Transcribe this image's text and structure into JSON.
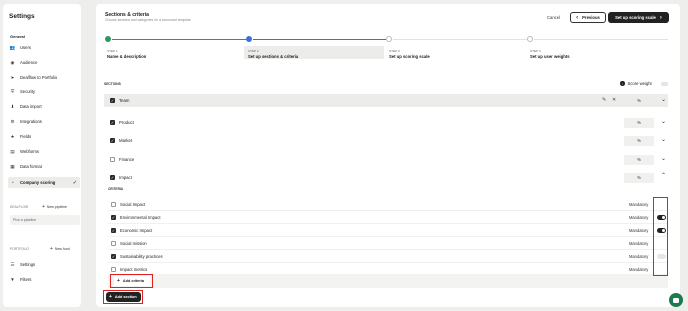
{
  "sidebar": {
    "title": "Settings",
    "general_heading": "General",
    "items": [
      {
        "label": "Users",
        "icon": "users-icon"
      },
      {
        "label": "Audience",
        "icon": "audience-icon"
      },
      {
        "label": "Dealflow to Portfolio",
        "icon": "send-icon"
      },
      {
        "label": "Security",
        "icon": "shield-icon"
      },
      {
        "label": "Data import",
        "icon": "download-icon"
      },
      {
        "label": "Integrations",
        "icon": "plug-icon"
      },
      {
        "label": "Fields",
        "icon": "star-icon"
      },
      {
        "label": "Webforms",
        "icon": "form-icon"
      },
      {
        "label": "Data format",
        "icon": "document-icon"
      },
      {
        "label": "Company scoring",
        "icon": "gauge-icon",
        "active": true
      }
    ],
    "dealflow_label": "DEALFLOW",
    "new_pipeline": "New pipeline",
    "pipeline_placeholder": "Pick a pipeline",
    "portfolio_label": "PORTFOLIO",
    "new_fund": "New fund",
    "bottom_items": [
      {
        "label": "Settings",
        "icon": "sliders-icon"
      },
      {
        "label": "Filters",
        "icon": "filter-icon"
      }
    ]
  },
  "header": {
    "title": "Sections & criteria",
    "subtitle": "Choose sections and categories for a scorecard template",
    "cancel": "Cancel",
    "previous": "Previous",
    "next": "Set up scoring scale"
  },
  "steps": [
    {
      "label": "STEP 1",
      "name": "Name & description",
      "state": "done"
    },
    {
      "label": "STEP 2",
      "name": "Set up sections & criteria",
      "state": "current"
    },
    {
      "label": "STEP 3",
      "name": "Set up scoring scale",
      "state": "todo"
    },
    {
      "label": "STEP 4",
      "name": "Set up user weights",
      "state": "todo"
    }
  ],
  "sections_label": "SECTIONS",
  "score_weight": "Score weight",
  "sections": [
    {
      "name": "Team",
      "checked": true,
      "pct": "%"
    },
    {
      "name": "Product",
      "checked": true,
      "pct": "%"
    },
    {
      "name": "Market",
      "checked": true,
      "pct": "%"
    },
    {
      "name": "Finance",
      "checked": false,
      "pct": "%"
    },
    {
      "name": "Impact",
      "checked": true,
      "pct": "%"
    }
  ],
  "criteria_label": "CRITERIA",
  "criteria": [
    {
      "name": "Social Impact",
      "checked": false,
      "mandatory": "Mandatory",
      "toggle": null
    },
    {
      "name": "Environmental Impact",
      "checked": true,
      "mandatory": "Mandatory",
      "toggle": true
    },
    {
      "name": "Economic Impact",
      "checked": true,
      "mandatory": "Mandatory",
      "toggle": true
    },
    {
      "name": "Social mission",
      "checked": false,
      "mandatory": "Mandatory",
      "toggle": null
    },
    {
      "name": "Sustainability practices",
      "checked": true,
      "mandatory": "Mandatory",
      "toggle": false
    },
    {
      "name": "Impact metrics",
      "checked": false,
      "mandatory": "Mandatory",
      "toggle": null
    }
  ],
  "add_criteria": "Add criteria",
  "add_section": "Add section",
  "colors": {
    "accent": "#3b6fe0",
    "done": "#2e9a5a",
    "highlight": "#d22222"
  }
}
